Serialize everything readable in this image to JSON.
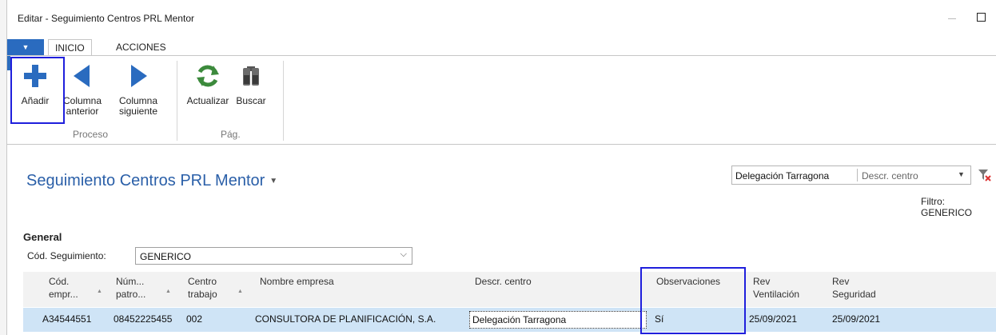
{
  "window": {
    "title": "Editar - Seguimiento Centros PRL Mentor"
  },
  "tabs": [
    {
      "label": "INICIO",
      "active": true
    },
    {
      "label": "ACCIONES",
      "active": false
    }
  ],
  "ribbon": {
    "buttons": {
      "add": "Añadir",
      "prev_col_line1": "Columna",
      "prev_col_line2": "anterior",
      "next_col_line1": "Columna",
      "next_col_line2": "siguiente",
      "refresh": "Actualizar",
      "search": "Buscar"
    },
    "groups": {
      "proceso": "Proceso",
      "pag": "Pág."
    }
  },
  "page": {
    "title": "Seguimiento Centros PRL Mentor",
    "filter_value": "Delegación Tarragona",
    "filter_field": "Descr. centro",
    "filter_status": "Filtro: GENERICO"
  },
  "general": {
    "section_label": "General",
    "cod_label": "Cód. Seguimiento:",
    "cod_value": "GENERICO"
  },
  "grid": {
    "headers": {
      "cod_l1": "Cód.",
      "cod_l2": "empr...",
      "num_l1": "Núm...",
      "num_l2": "patro...",
      "centro_l1": "Centro",
      "centro_l2": "trabajo",
      "nombre": "Nombre empresa",
      "descr": "Descr. centro",
      "obs": "Observaciones",
      "rev_vent_l1": "Rev",
      "rev_vent_l2": "Ventilación",
      "rev_seg_l1": "Rev",
      "rev_seg_l2": "Seguridad"
    },
    "row": {
      "cod": "A34544551",
      "num": "08452225455",
      "centro": "002",
      "nombre": "CONSULTORA DE PLANIFICACIÓN, S.A.",
      "descr": "Delegación Tarragona",
      "obs": "Sí",
      "rev_vent": "25/09/2021",
      "rev_seg": "25/09/2021"
    }
  },
  "colors": {
    "accent": "#2a6bbf",
    "title_blue": "#2a5fa8",
    "selected_row": "#cfe4f6",
    "highlight_box": "#1f1fdc",
    "add_icon": "#2a6bbf",
    "refresh_icon": "#3c8a3c"
  }
}
